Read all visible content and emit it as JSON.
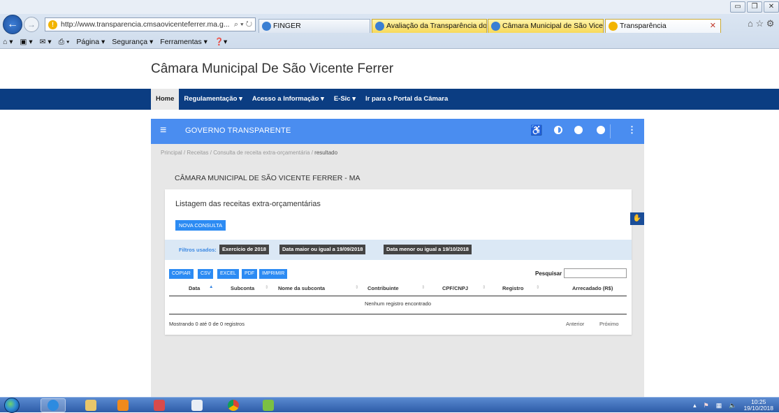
{
  "browser": {
    "address": "http://www.transparencia.cmsaovicenteferrer.ma.g...",
    "address_ctrls": "⌕ ▾ ↻",
    "tabs": [
      {
        "label": "FINGER"
      },
      {
        "label": "Avaliação da Transparência do..."
      },
      {
        "label": "Câmara Municipal de São Vice..."
      },
      {
        "label": "Transparência"
      }
    ],
    "command_bar": [
      "Página ▾",
      "Segurança ▾",
      "Ferramentas ▾"
    ]
  },
  "site": {
    "title": "Câmara Municipal De São Vicente Ferrer",
    "nav": [
      "Home",
      "Regulamentação ▾",
      "Acesso a Informação ▾",
      "E-Sic ▾",
      "Ir para o Portal da Câmara"
    ]
  },
  "panel": {
    "header": "GOVERNO TRANSPARENTE",
    "breadcrumb": [
      "Principal",
      "Receitas",
      "Consulta de receita extra-orçamentária",
      "resultado"
    ],
    "entity": "CÂMARA MUNICIPAL DE SÃO VICENTE FERRER - MA"
  },
  "card": {
    "title": "Listagem das receitas extra-orçamentárias",
    "new_query_button": "NOVA CONSULTA",
    "filters_label": "Filtros usados:",
    "filters": [
      "Exercício de 2018",
      "Data maior ou igual a 19/09/2018",
      "Data menor ou igual a 19/10/2018"
    ],
    "export_buttons": [
      "COPIAR",
      "CSV",
      "EXCEL",
      "PDF",
      "IMPRIMIR"
    ],
    "search_label": "Pesquisar",
    "columns": [
      "Data",
      "Subconta",
      "Nome da subconta",
      "Contribuinte",
      "CPF/CNPJ",
      "Registro",
      "Arrecadado (R$)"
    ],
    "empty_message": "Nenhum registro encontrado",
    "info": "Mostrando 0 até 0 de 0 registros",
    "prev": "Anterior",
    "next": "Próximo"
  },
  "taskbar": {
    "time": "10:25",
    "date": "19/10/2018"
  },
  "colors": {
    "nav_bg": "#0b3d82",
    "panel_header": "#4a8df0",
    "button_blue": "#2c8bf3",
    "filter_bg": "#dbe8f5",
    "badge_dark": "#444444"
  }
}
